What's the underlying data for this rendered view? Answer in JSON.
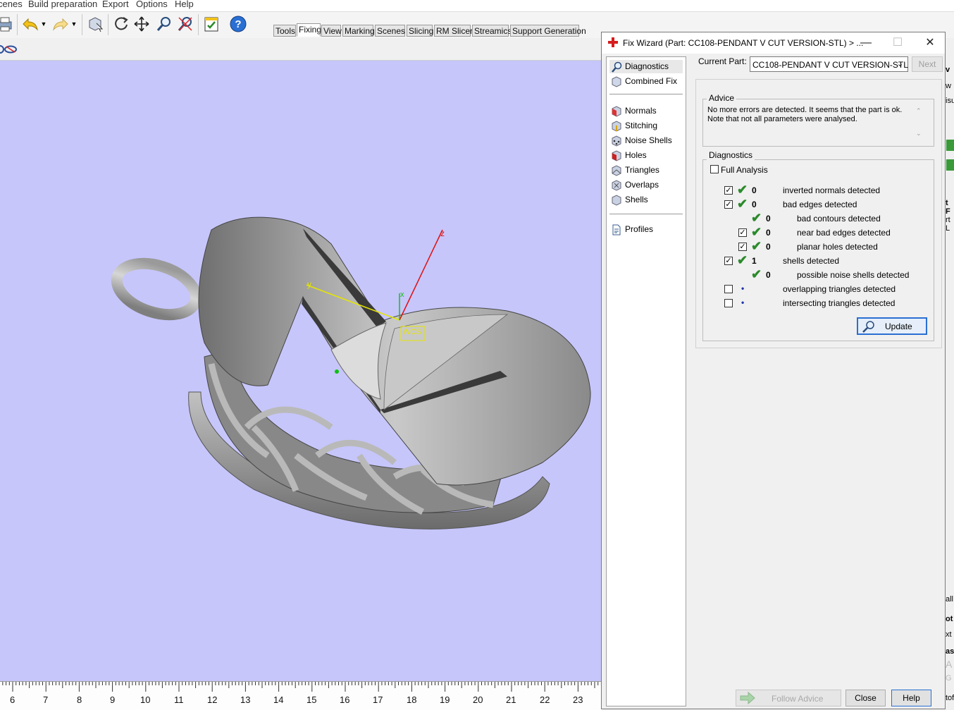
{
  "menu": [
    "cenes",
    "Build preparation",
    "Export",
    "Options",
    "Help"
  ],
  "toolbar": {
    "icons": [
      "printer-icon",
      "undo-icon",
      "redo-icon",
      "part-select-icon",
      "rotate-icon",
      "move-icon",
      "zoom-icon",
      "zoom-fit-icon",
      "checklist-icon",
      "help-icon"
    ],
    "tabs": [
      "Tools",
      "Fixing",
      "View",
      "Marking",
      "Scenes",
      "Slicing",
      "RM Slicer",
      "Streamics",
      "Support Generation"
    ],
    "active_tab": "Fixing"
  },
  "viewport": {
    "background": "#c6c6fb",
    "axis_labels": {
      "z": "z",
      "y": "y",
      "x": "x",
      "wcs": "WCS"
    }
  },
  "ruler": {
    "labels": [
      "6",
      "7",
      "8",
      "9",
      "10",
      "11",
      "12",
      "13",
      "14",
      "15",
      "16",
      "17",
      "18",
      "19",
      "20",
      "21",
      "22",
      "23"
    ]
  },
  "dialog": {
    "title": "Fix Wizard (Part: CC108-PENDANT V CUT VERSION-STL) > ...",
    "current_part_label": "Current Part:",
    "current_part_value": "CC108-PENDANT V CUT VERSION-STL",
    "next_label": "Next",
    "nav": [
      {
        "label": "Diagnostics",
        "icon": "magnifier-icon"
      },
      {
        "label": "Combined Fix",
        "icon": "cube-icon"
      },
      {
        "label": "Normals",
        "icon": "normals-cube-icon"
      },
      {
        "label": "Stitching",
        "icon": "stitch-cube-icon"
      },
      {
        "label": "Noise Shells",
        "icon": "noise-cube-icon"
      },
      {
        "label": "Holes",
        "icon": "holes-cube-icon"
      },
      {
        "label": "Triangles",
        "icon": "triangles-cube-icon"
      },
      {
        "label": "Overlaps",
        "icon": "overlaps-cube-icon"
      },
      {
        "label": "Shells",
        "icon": "shells-cube-icon"
      },
      {
        "label": "Profiles",
        "icon": "document-icon"
      }
    ],
    "advice_title": "Advice",
    "advice_line1": "No more errors are detected. It seems that the part is ok.",
    "advice_line2": "Note that not all parameters were analysed.",
    "diagnostics_title": "Diagnostics",
    "full_analysis": "Full Analysis",
    "rows": [
      {
        "count": "0",
        "label": "inverted normals detected"
      },
      {
        "count": "0",
        "label": "bad edges detected"
      },
      {
        "count": "0",
        "label": "bad contours detected"
      },
      {
        "count": "0",
        "label": "near bad edges detected"
      },
      {
        "count": "0",
        "label": "planar holes detected"
      },
      {
        "count": "1",
        "label": "shells detected"
      },
      {
        "count": "0",
        "label": "possible noise shells detected"
      },
      {
        "count": "",
        "label": "overlapping triangles detected"
      },
      {
        "count": "",
        "label": "intersecting triangles detected"
      }
    ],
    "update_label": "Update",
    "follow_advice_label": "Follow Advice",
    "close_label": "Close",
    "help_label": "Help"
  },
  "right_panel_fragments": [
    "v",
    "w",
    "isu",
    "t F",
    "rt L",
    "all",
    "ot",
    "xt",
    "as",
    "A",
    "G",
    "tof"
  ]
}
